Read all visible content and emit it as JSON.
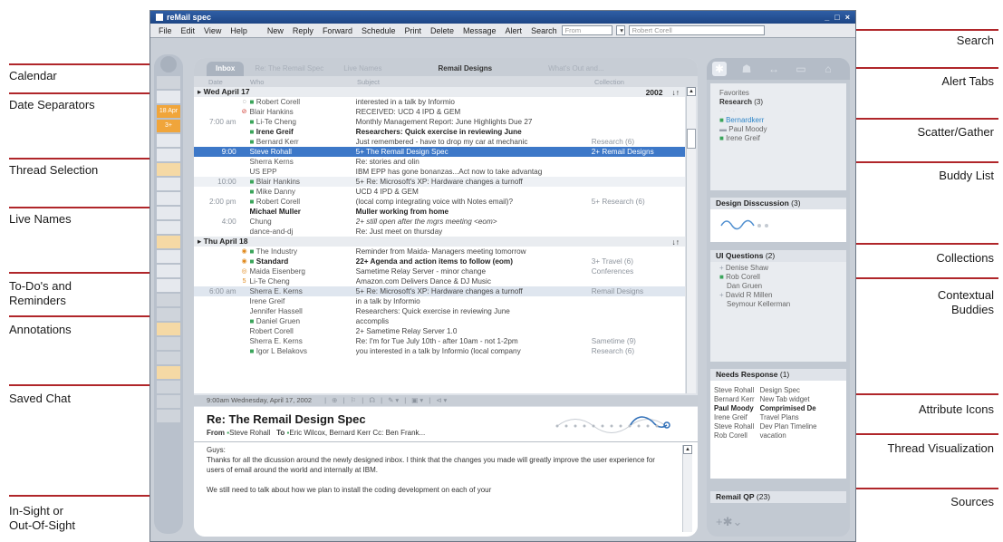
{
  "window": {
    "title": "reMail spec",
    "controls": [
      "_",
      "□",
      "×"
    ]
  },
  "menu": {
    "items": [
      "File",
      "Edit",
      "View",
      "Help"
    ],
    "actions": [
      "New",
      "Reply",
      "Forward",
      "Schedule",
      "Print",
      "Delete",
      "Message",
      "Alert",
      "Search"
    ],
    "search_scope": "From",
    "search_value": "Robert Corell"
  },
  "calendar": {
    "cells": [
      "18 Apr",
      "3+"
    ]
  },
  "tabs": [
    "Inbox",
    "Re: The Remail Spec",
    "Live Names",
    "Remail Designs",
    "What's Out and..."
  ],
  "columns": [
    "Date",
    "Who",
    "Subject",
    "Collection"
  ],
  "groups": [
    {
      "label": "Wed   April 17",
      "year": "2002",
      "sort": "↓↑",
      "rows": [
        {
          "time": "",
          "who": "Robert Corell",
          "subject": "interested in a talk by Informio",
          "coll": "",
          "dot": "g",
          "ind": "◌"
        },
        {
          "time": "",
          "who": "Blair Hankins",
          "subject": "RECEIVED: UCD 4 IPD & GEM",
          "coll": "",
          "dot": "",
          "ind": "⊘"
        },
        {
          "time": "7:00 am",
          "who": "Li-Te Cheng",
          "subject": "Monthly Management Report: June Highlights Due 27",
          "coll": "",
          "dot": "g",
          "ind": ""
        },
        {
          "time": "",
          "who": "Irene Greif",
          "subject": "Researchers: Quick exercise in reviewing June",
          "coll": "",
          "dot": "g",
          "ind": "",
          "bold": true
        },
        {
          "time": "",
          "who": "Bernard Kerr",
          "subject": "Just remembered - have to drop my car at mechanic",
          "coll": "Research (6)",
          "dot": "g",
          "ind": ""
        },
        {
          "time": "9:00",
          "who": "Steve Rohall",
          "subject": "5+ The Remail Design Spec",
          "coll": "2+ Remail Designs",
          "dot": "",
          "ind": "",
          "selected": true
        },
        {
          "time": "",
          "who": "Sherra Kerns",
          "subject": "Re: stories and olin",
          "coll": "",
          "dot": "",
          "ind": ""
        },
        {
          "time": "",
          "who": "US EPP",
          "subject": "IBM EPP has gone bonanzas...Act now to take advantag",
          "coll": "",
          "dot": "",
          "ind": ""
        },
        {
          "time": "10:00",
          "who": "Blair Hankins",
          "subject": "5+ Re: Microsoft's XP: Hardware changes a turnoff",
          "coll": "",
          "dot": "g",
          "ind": "",
          "tint": true
        },
        {
          "time": "",
          "who": "Mike Danny",
          "subject": "UCD 4 IPD & GEM",
          "coll": "",
          "dot": "g",
          "ind": ""
        },
        {
          "time": "2:00 pm",
          "who": "Robert Corell",
          "subject": "(local comp integrating voice with Notes email)?",
          "coll": "5+ Research (6)",
          "dot": "g",
          "ind": ""
        },
        {
          "time": "",
          "who": "Michael Muller",
          "subject": "Muller working from home",
          "coll": "",
          "dot": "",
          "ind": "",
          "bold": true
        },
        {
          "time": "4:00",
          "who": "Chung",
          "subject": "2+ still open after the mgrs meeting <eom>",
          "coll": "",
          "dot": "",
          "ind": "",
          "italic": true
        },
        {
          "time": "",
          "who": "dance-and-dj",
          "subject": "Re: Just meet on thursday",
          "coll": "",
          "dot": "",
          "ind": ""
        }
      ]
    },
    {
      "label": "Thu   April 18",
      "year": "",
      "sort": "↓↑",
      "rows": [
        {
          "time": "",
          "who": "The Industry",
          "subject": "Reminder from Maida- Managers meeting tomorrow",
          "coll": "",
          "dot": "g",
          "ind": "◉"
        },
        {
          "time": "",
          "who": "Standard",
          "subject": "22+ Agenda and action items to follow (eom)",
          "coll": "3+ Travel (6)",
          "dot": "g",
          "ind": "◉",
          "bold": true
        },
        {
          "time": "",
          "who": "Maida Eisenberg",
          "subject": "Sametime Relay Server - minor change",
          "coll": "Conferences",
          "dot": "",
          "ind": "◎"
        },
        {
          "time": "",
          "who": "Li-Te Cheng",
          "subject": "Amazon.com Delivers Dance & DJ Music",
          "coll": "",
          "dot": "",
          "ind": "5"
        },
        {
          "time": "6:00 am",
          "who": "Sherra E. Kerns",
          "subject": "5+ Re: Microsoft's XP: Hardware changes a turnoff",
          "coll": "Remail Designs",
          "dot": "",
          "ind": "",
          "highlight": true
        },
        {
          "time": "",
          "who": "Irene Greif",
          "subject": "in a talk by Informio",
          "coll": "",
          "dot": "",
          "ind": ""
        },
        {
          "time": "",
          "who": "Jennifer Hassell",
          "subject": "Researchers: Quick exercise in reviewing June",
          "coll": "",
          "dot": "",
          "ind": ""
        },
        {
          "time": "",
          "who": "Daniel Gruen",
          "subject": "accomplis",
          "coll": "",
          "dot": "g",
          "ind": ""
        },
        {
          "time": "",
          "who": "Robert Corell",
          "subject": "2+ Sametime Relay Server 1.0",
          "coll": "",
          "dot": "",
          "ind": ""
        },
        {
          "time": "",
          "who": "Sherra E. Kerns",
          "subject": "Re: I'm for Tue July 10th - after 10am - not 1-2pm",
          "coll": "Sametime (9)",
          "dot": "",
          "ind": ""
        },
        {
          "time": "",
          "who": "Igor L Belakovs",
          "subject": "you interested in a talk by Informio (local company",
          "coll": "Research (6)",
          "dot": "g",
          "ind": ""
        }
      ]
    }
  ],
  "status": {
    "text": "9:00am Wednesday, April 17, 2002"
  },
  "message": {
    "subject": "Re: The Remail Design Spec",
    "from_label": "From",
    "from": "Steve Rohall",
    "to_label": "To",
    "to": "Eric Wilcox, Bernard Kerr Cc: Ben Frank...",
    "body": [
      "Guys:",
      "Thanks for all the dicussion around the newly designed inbox. I think that the changes you made will greatly improve the user experience for users of email around the world and internally at IBM.",
      "We still need to talk about how we plan to install the coding development on each of your"
    ]
  },
  "sidebar": {
    "favorites_label": "Favorites",
    "research": {
      "name": "Research",
      "count": "(3)"
    },
    "research_members": [
      "Bernardkerr",
      "Paul Moody",
      "Irene Greif"
    ],
    "design": {
      "name": "Design Disscussion",
      "count": "(3)"
    },
    "ui": {
      "name": "UI Questions",
      "count": "(2)"
    },
    "ui_members": [
      "Denise Shaw",
      "Rob Corell",
      "Dan Gruen",
      "David R Millen",
      "Seymour Kellerman"
    ],
    "needs": {
      "name": "Needs Response",
      "count": "(1)"
    },
    "needs_rows": [
      [
        "Steve Rohall",
        "Design Spec"
      ],
      [
        "Bernard Kerr",
        "New Tab widget"
      ],
      [
        "Paul Moody",
        "Comprimised De"
      ],
      [
        "Irene Greif",
        "Travel Plans"
      ],
      [
        "Steve Rohall",
        "Dev Plan Timeline"
      ],
      [
        "Rob Corell",
        "vacation"
      ]
    ],
    "remailqp": {
      "name": "Remail QP",
      "count": "(23)"
    },
    "footer_icon": "+✱⌄"
  },
  "callouts": {
    "left": [
      "Calendar",
      "Date Separators",
      "Thread Selection",
      "Live Names",
      "To-Do's and",
      "Reminders",
      "Annotations",
      "Saved Chat",
      "In-Sight or",
      "Out-Of-Sight"
    ],
    "right": [
      "Search",
      "Alert Tabs",
      "Scatter/Gather",
      "Buddy List",
      "Collections",
      "Contextual",
      "Buddies",
      "Attribute Icons",
      "Thread Visualization",
      "Sources"
    ]
  },
  "colors": {
    "accent": "#3d78c8",
    "callout_line": "#b0262a",
    "live_dot": "#3ba55b"
  }
}
